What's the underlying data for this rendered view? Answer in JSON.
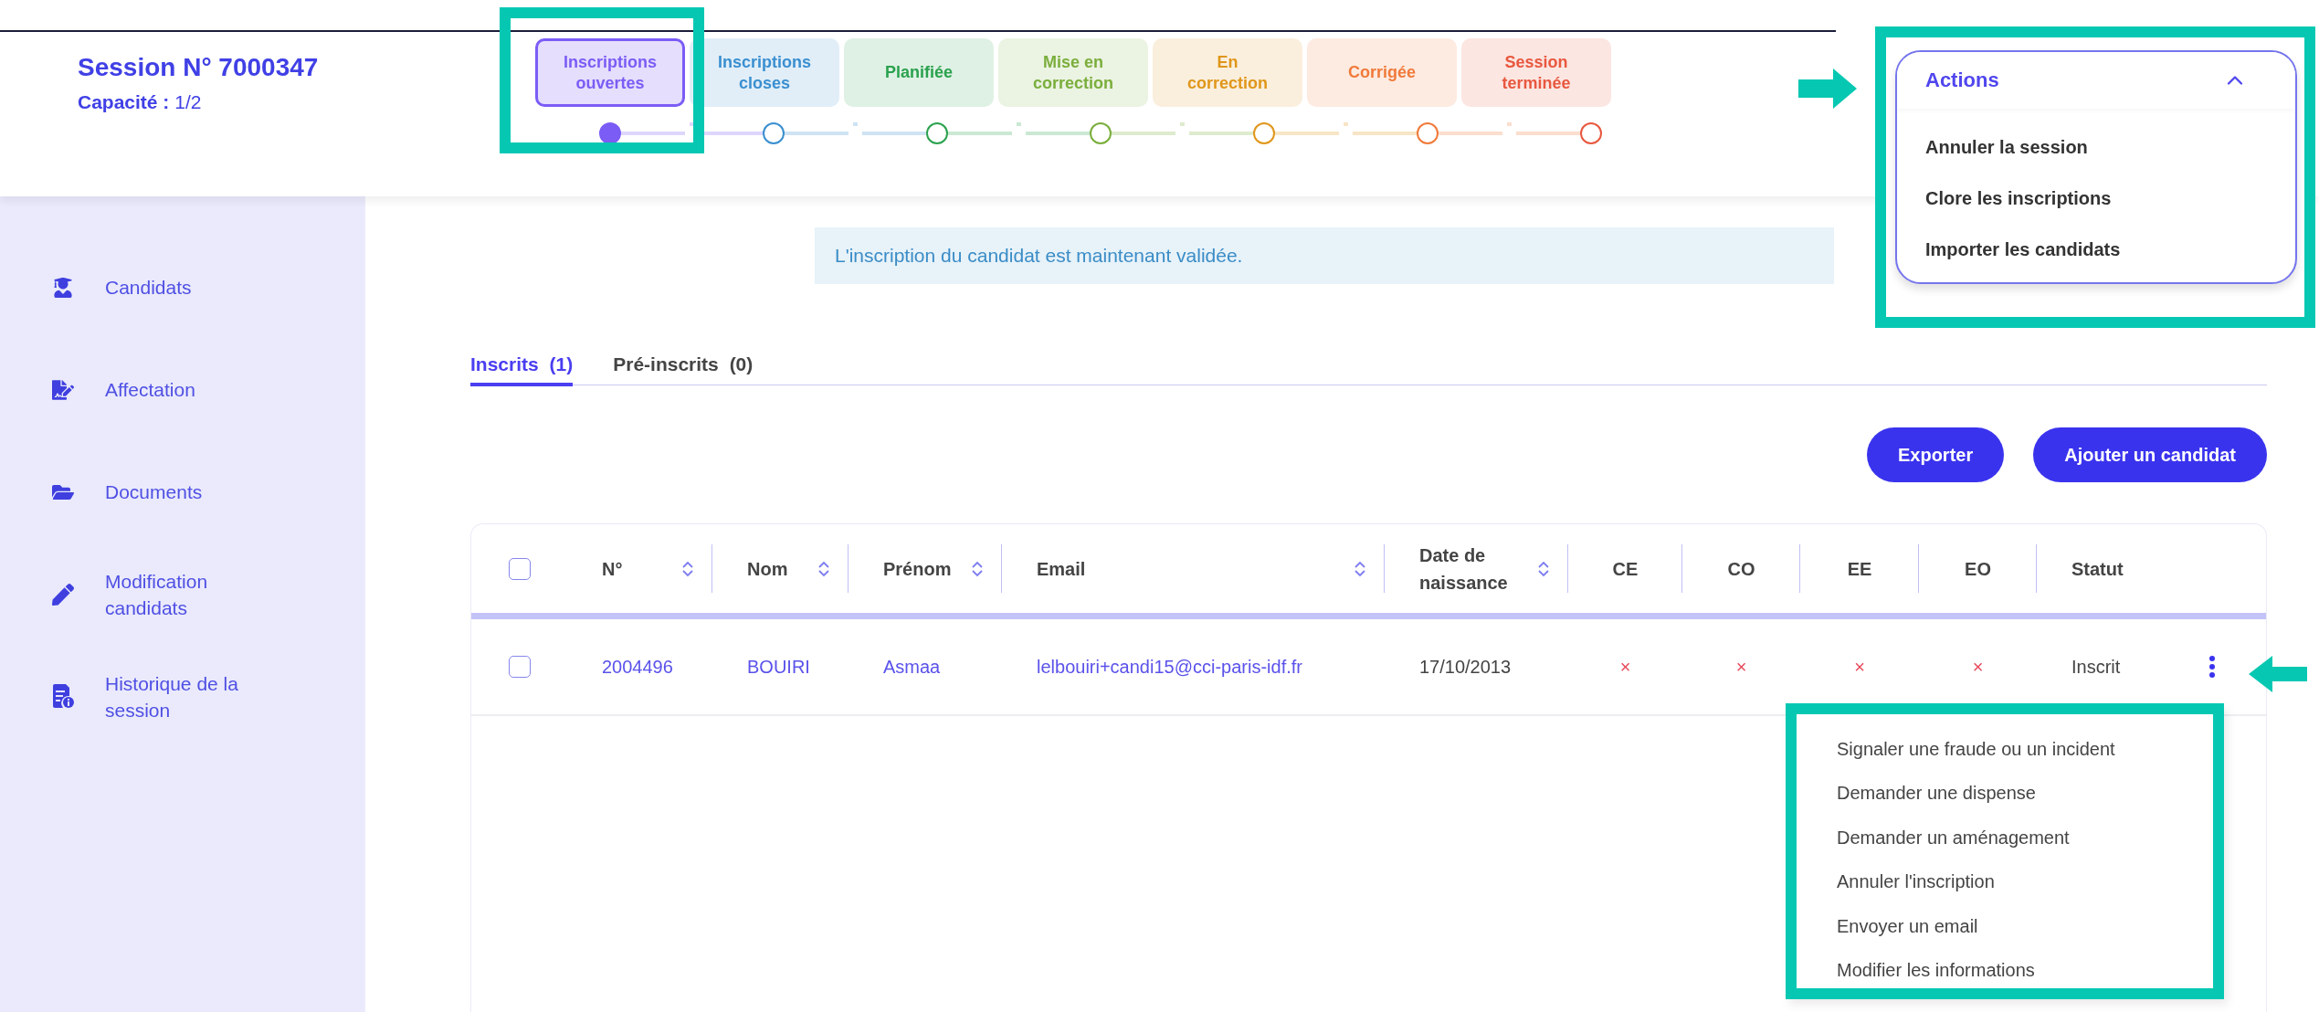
{
  "session": {
    "title": "Session N° 7000347",
    "capacity_label": "Capacité :",
    "capacity_value": "1/2"
  },
  "steps": [
    {
      "label": "Inscriptions ouvertes",
      "color": "#7b5cf5",
      "selected": true
    },
    {
      "label": "Inscriptions closes",
      "color": "#3a8fd0",
      "selected": false
    },
    {
      "label": "Planifiée",
      "color": "#2aa24e",
      "selected": false
    },
    {
      "label": "Mise en correction",
      "color": "#7aae3c",
      "selected": false
    },
    {
      "label": "En correction",
      "color": "#e0961a",
      "selected": false
    },
    {
      "label": "Corrigée",
      "color": "#f07a3a",
      "selected": false
    },
    {
      "label": "Session terminée",
      "color": "#e8583f",
      "selected": false
    }
  ],
  "actions_menu": {
    "label": "Actions",
    "expanded": true,
    "items": [
      "Annuler la session",
      "Clore les inscriptions",
      "Importer les candidats"
    ]
  },
  "sidebar": {
    "items": [
      {
        "label": "Candidats"
      },
      {
        "label": "Affectation"
      },
      {
        "label": "Documents"
      },
      {
        "label": "Modification candidats"
      },
      {
        "label": "Historique de la session"
      }
    ]
  },
  "alert": "L'inscription du candidat est maintenant validée.",
  "tabs": [
    {
      "label": "Inscrits",
      "count": "(1)",
      "selected": true
    },
    {
      "label": "Pré-inscrits",
      "count": "(0)",
      "selected": false
    }
  ],
  "buttons": [
    "Exporter",
    "Ajouter un candidat"
  ],
  "table": {
    "select_all_checked": false,
    "columns": [
      {
        "label": "N°",
        "sortable": true
      },
      {
        "label": "Nom",
        "sortable": true
      },
      {
        "label": "Prénom",
        "sortable": true
      },
      {
        "label": "Email",
        "sortable": true
      },
      {
        "label": "Date de naissance",
        "sortable": true
      },
      {
        "label": "CE",
        "sortable": false
      },
      {
        "label": "CO",
        "sortable": false
      },
      {
        "label": "EE",
        "sortable": false
      },
      {
        "label": "EO",
        "sortable": false
      },
      {
        "label": "Statut",
        "sortable": false
      }
    ],
    "rows": [
      {
        "checked": false,
        "cells": [
          "2004496",
          "BOUIRI",
          "Asmaa",
          "lelbouiri+candi15@cci-paris-idf.fr",
          "17/10/2013",
          "×",
          "×",
          "×",
          "×",
          "Inscrit"
        ]
      }
    ]
  },
  "row_menu": {
    "open": true,
    "items": [
      "Signaler une fraude ou un incident",
      "Demander une dispense",
      "Demander un aménagement",
      "Annuler l'inscription",
      "Envoyer un email",
      "Modifier les informations"
    ]
  }
}
